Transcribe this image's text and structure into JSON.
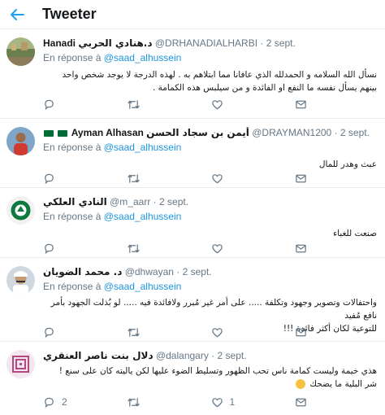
{
  "header": {
    "title": "Tweeter"
  },
  "reply_prefix": "En réponse à",
  "reply_to": "@saad_alhussein",
  "tweets": [
    {
      "name": "Hanadi",
      "name_ar": "د.هنادي الحربي",
      "handle": "@DRHANADIALHARBI",
      "date": "2 sept.",
      "text": "نسأل الله السلامه و الحمدلله الذي عافانا مما ابتلاهم به . لهذه الدرجة لا يوجد شخص واحد بينهم يسأل نفسه ما النفع او الفائدة و من سيلبس هذه الكمامة .",
      "replies": "",
      "retweets": "",
      "likes": ""
    },
    {
      "name": "Ayman Alhasan",
      "name_ar": "أيمن بن سجاد الحسن",
      "handle": "@DRAYMAN1200",
      "date": "2 sept.",
      "text": "عبث وهدر للمال",
      "replies": "",
      "retweets": "",
      "likes": ""
    },
    {
      "name": "",
      "name_ar": "النادي العلكي",
      "handle": "@m_aarr",
      "date": "2 sept.",
      "text": "صنعت للغباء",
      "replies": "",
      "retweets": "",
      "likes": ""
    },
    {
      "name": "",
      "name_ar": "د. محمد الضويان",
      "handle": "@dhwayan",
      "date": "2 sept.",
      "text_line1": "واحتفالات وتصوير وجهود وتكلفة ..... على أمر غير مُبرر ولافائدة فيه ..... لو بُذلت الجهود بأمر نافع مُفيد",
      "text_line2": "للتوعية لكان أكثر فائدة !!!",
      "replies": "",
      "retweets": "",
      "likes": ""
    },
    {
      "name": "",
      "name_ar": "دلال بنت ناصر العنقري",
      "handle": "@dalangary",
      "date": "2 sept.",
      "text_line1": "هذي خيمة وليست كمامة ناس تحب الظهور وتسليط الضوء عليها لكن ياليته كان على سنع !",
      "text_line2": "شر البلية ما يضحك",
      "replies": "2",
      "retweets": "",
      "likes": "1"
    }
  ],
  "colors": {
    "accent": "#1b95e0",
    "muted": "#657786",
    "border": "#e6ecf0"
  }
}
